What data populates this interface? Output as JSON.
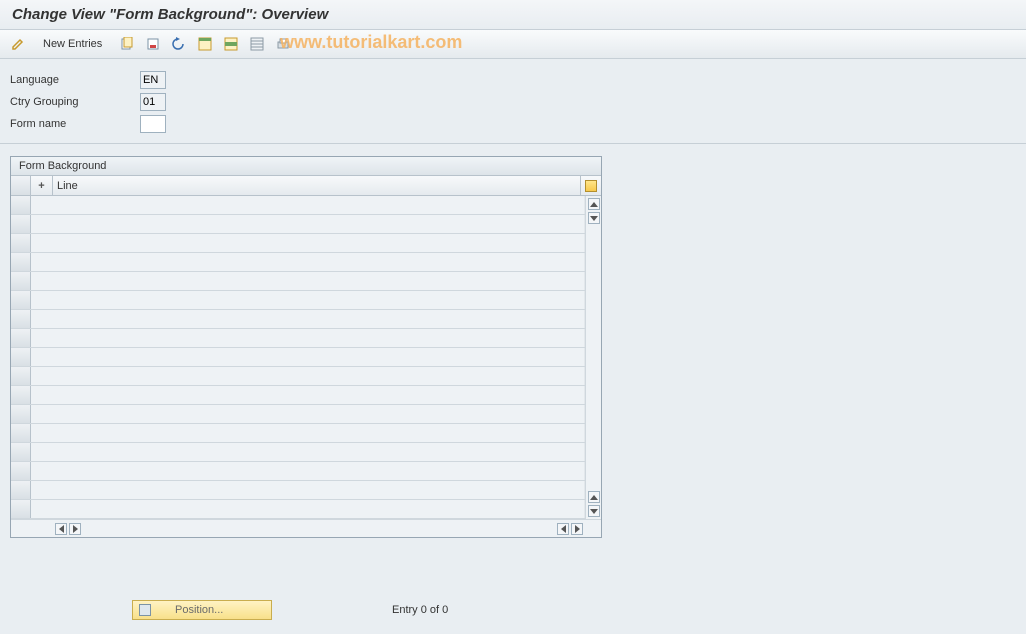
{
  "title": "Change View \"Form Background\": Overview",
  "watermark": "www.tutorialkart.com",
  "toolbar": {
    "new_entries_label": "New Entries"
  },
  "fields": {
    "language": {
      "label": "Language",
      "value": "EN"
    },
    "ctry_grouping": {
      "label": "Ctry Grouping",
      "value": "01"
    },
    "form_name": {
      "label": "Form name",
      "value": ""
    }
  },
  "grid": {
    "title": "Form Background",
    "columns": {
      "plus": "+",
      "line": "Line"
    },
    "row_count": 17
  },
  "footer": {
    "position_label": "Position...",
    "entry_label": "Entry 0 of 0"
  }
}
